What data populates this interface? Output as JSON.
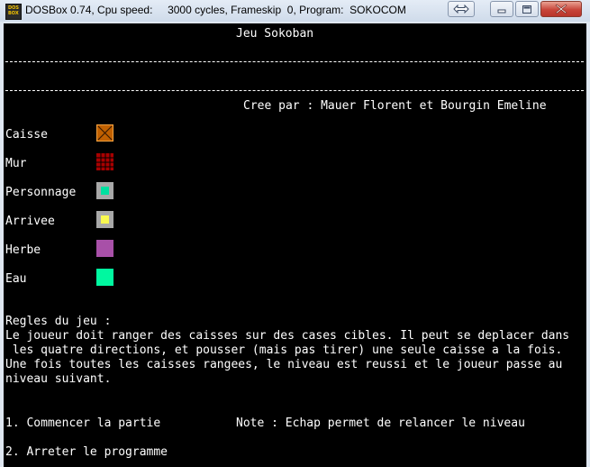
{
  "window": {
    "title": "DOSBox 0.74, Cpu speed:     3000 cycles, Frameskip  0, Program:  SOKOCOM",
    "icon_text": [
      "DOS",
      "BOX"
    ],
    "buttons": [
      "resize-arrows-icon",
      "minimize-icon",
      "maximize-icon",
      "close-icon"
    ]
  },
  "screen": {
    "header": "Jeu Sokoban",
    "credit": "Cree par : Mauer Florent et Bourgin Emeline",
    "legend": [
      {
        "label": "Caisse",
        "icon": "crate-icon",
        "color": "#c06000"
      },
      {
        "label": "Mur",
        "icon": "wall-icon",
        "color": "#a80000"
      },
      {
        "label": "Personnage",
        "icon": "player-icon",
        "color": "#00e0a0"
      },
      {
        "label": "Arrivee",
        "icon": "target-icon",
        "color": "#f8f850"
      },
      {
        "label": "Herbe",
        "icon": "grass-icon",
        "color": "#a850a8"
      },
      {
        "label": "Eau",
        "icon": "water-icon",
        "color": "#00f8a0"
      }
    ],
    "rules_title": "Regles du jeu :",
    "rules_lines": [
      "Le joueur doit ranger des caisses sur des cases cibles. Il peut se deplacer dans",
      " les quatre directions, et pousser (mais pas tirer) une seule caisse a la fois.",
      "Une fois toutes les caisses rangees, le niveau est reussi et le joueur passe au",
      "niveau suivant."
    ],
    "menu": {
      "start": "1. Commencer la partie",
      "note": "Note : Echap permet de relancer le niveau",
      "stop": "2. Arreter le programme"
    }
  }
}
